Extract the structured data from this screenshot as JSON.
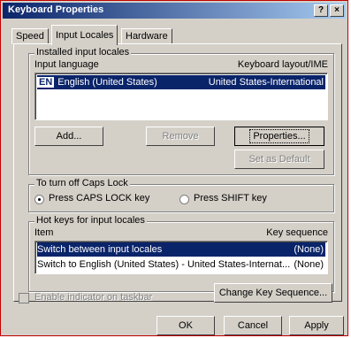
{
  "window": {
    "title": "Keyboard Properties",
    "help_glyph": "?",
    "close_glyph": "×"
  },
  "tabs": [
    {
      "label": "Speed"
    },
    {
      "label": "Input Locales"
    },
    {
      "label": "Hardware"
    }
  ],
  "installed": {
    "group_title": "Installed input locales",
    "col_language": "Input language",
    "col_layout": "Keyboard layout/IME",
    "items": [
      {
        "flag": "EN",
        "language": "English (United States)",
        "layout": "United States-International"
      }
    ],
    "buttons": {
      "add": "Add...",
      "remove": "Remove",
      "properties": "Properties...",
      "set_default": "Set as Default"
    }
  },
  "caps": {
    "group_title": "To turn off Caps Lock",
    "option_caps": "Press CAPS LOCK key",
    "option_shift": "Press SHIFT key"
  },
  "hotkeys": {
    "group_title": "Hot keys for input locales",
    "col_item": "Item",
    "col_seq": "Key sequence",
    "rows": [
      {
        "item": "Switch between input locales",
        "seq": "(None)"
      },
      {
        "item": "Switch to English (United States) - United States-Internat...",
        "seq": "(None)"
      }
    ],
    "change_button": "Change Key Sequence..."
  },
  "indicator": {
    "label": "Enable indicator on taskbar"
  },
  "footer": {
    "ok": "OK",
    "cancel": "Cancel",
    "apply": "Apply"
  }
}
